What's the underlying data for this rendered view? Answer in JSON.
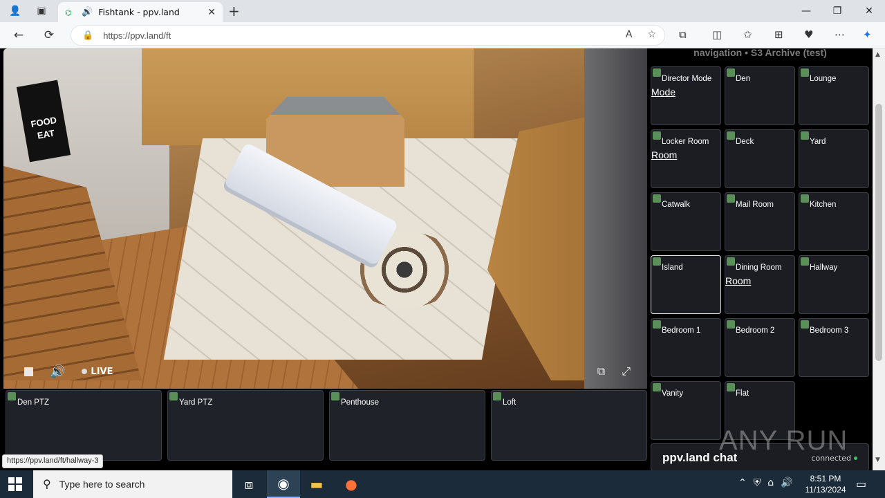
{
  "browser": {
    "tab_title": "Fishtank - ppv.land",
    "url": "https://ppv.land/ft",
    "status_url": "https://ppv.land/ft/hallway-3"
  },
  "video": {
    "live_label": "LIVE",
    "sign_text": "FOOD EAT"
  },
  "bottom_tiles": [
    {
      "label": "Den PTZ"
    },
    {
      "label": "Yard PTZ"
    },
    {
      "label": "Penthouse"
    },
    {
      "label": "Loft"
    }
  ],
  "nav": {
    "header": "navigation • S3 Archive (test)",
    "cameras": [
      {
        "label": "Director Mode",
        "sub": "Mode"
      },
      {
        "label": "Den",
        "sub": ""
      },
      {
        "label": "Lounge",
        "sub": ""
      },
      {
        "label": "Locker Room",
        "sub": "Room"
      },
      {
        "label": "Deck",
        "sub": ""
      },
      {
        "label": "Yard",
        "sub": ""
      },
      {
        "label": "Catwalk",
        "sub": ""
      },
      {
        "label": "Mail Room",
        "sub": ""
      },
      {
        "label": "Kitchen",
        "sub": ""
      },
      {
        "label": "Island",
        "sub": "",
        "active": true
      },
      {
        "label": "Dining Room",
        "sub": "Room"
      },
      {
        "label": "Hallway",
        "sub": ""
      },
      {
        "label": "Bedroom 1",
        "sub": ""
      },
      {
        "label": "Bedroom 2",
        "sub": ""
      },
      {
        "label": "Bedroom 3",
        "sub": ""
      },
      {
        "label": "Vanity",
        "sub": ""
      },
      {
        "label": "Flat",
        "sub": ""
      }
    ]
  },
  "chat": {
    "title": "ppv.land chat",
    "status": "connected"
  },
  "watermark": "ANY RUN",
  "taskbar": {
    "search_placeholder": "Type here to search",
    "time": "8:51 PM",
    "date": "11/13/2024"
  }
}
